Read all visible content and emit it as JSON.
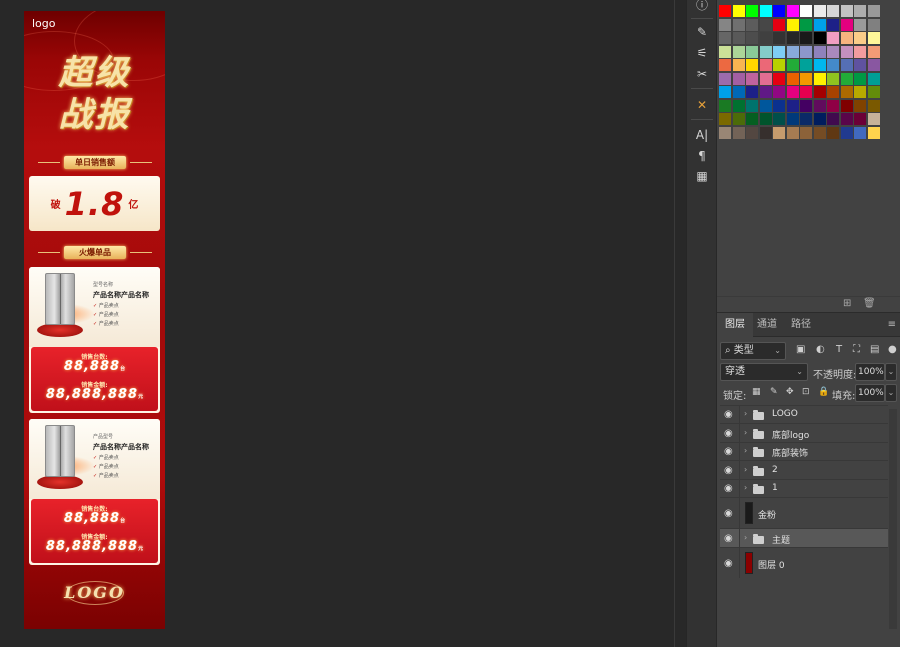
{
  "canvas": {
    "logo_top": "logo",
    "headline_line1": "超级",
    "headline_line2": "战报",
    "ribbon_daily": "单日销售额",
    "sales_prefix": "破",
    "sales_value": "1.8",
    "sales_suffix": "亿",
    "ribbon_hot": "火爆单品",
    "products": [
      {
        "tag": "型号名称",
        "name": "产品名称产品名称",
        "features": [
          "产品卖点",
          "产品卖点",
          "产品卖点"
        ],
        "units_label": "销售台数:",
        "units_value": "88,888",
        "units_unit": "台",
        "amount_label": "销售金额:",
        "amount_value": "88,888,888",
        "amount_unit": "元"
      },
      {
        "tag": "产品型号",
        "name": "产品名称产品名称",
        "features": [
          "产品卖点",
          "产品卖点",
          "产品卖点"
        ],
        "units_label": "销售台数:",
        "units_value": "88,888",
        "units_unit": "台",
        "amount_label": "销售金额:",
        "amount_value": "88,888,888",
        "amount_unit": "元"
      }
    ],
    "logo_bottom": "LOGO"
  },
  "toolbar": {
    "icons": [
      "info-icon",
      "brush-settings-icon",
      "adjustments-icon",
      "clone-tool-icon",
      "tools-crossed-icon",
      "character-icon",
      "paragraph-icon",
      "glyphs-icon"
    ]
  },
  "swatches": {
    "rows": [
      [
        "#ff0000",
        "#ffff00",
        "#00ff00",
        "#00ffff",
        "#0000ff",
        "#ff00ff",
        "#ffffff",
        "#ebebeb",
        "#d6d6d6",
        "#c2c2c2",
        "#adadad",
        "#999999"
      ],
      [
        "#858585",
        "#707070",
        "#5c5c5c",
        "#474747",
        "#e60012",
        "#fff100",
        "#009944",
        "#00a0e9",
        "#1d2088",
        "#e4007f",
        "#9a9a9a",
        "#808080"
      ],
      [
        "#666666",
        "#595959",
        "#4d4d4d",
        "#404040",
        "#333333",
        "#262626",
        "#1a1a1a",
        "#000000",
        "#f19ec2",
        "#f6b37f",
        "#facd89",
        "#fff799"
      ],
      [
        "#cce198",
        "#acd598",
        "#89c997",
        "#84ccc9",
        "#7ecef4",
        "#88abda",
        "#8c97cb",
        "#8f82bc",
        "#aa89bd",
        "#c490bf",
        "#f29c9f",
        "#f29b76"
      ],
      [
        "#ec6941",
        "#f8b551",
        "#ffd800",
        "#eb6877",
        "#b8d200",
        "#22ac38",
        "#00a29a",
        "#00b7ee",
        "#448aca",
        "#556fb5",
        "#5f52a0",
        "#8957a1"
      ],
      [
        "#9c6bac",
        "#a35fa3",
        "#c0639e",
        "#e26d92",
        "#e60012",
        "#eb6100",
        "#f39800",
        "#fff100",
        "#8fc31f",
        "#22ac38",
        "#009944",
        "#009e96"
      ],
      [
        "#00a0e9",
        "#0068b7",
        "#1d2088",
        "#601986",
        "#920783",
        "#e4007f",
        "#e5004f",
        "#a40000",
        "#a84200",
        "#ac6a00",
        "#b7aa00",
        "#638c0b"
      ],
      [
        "#1a7a23",
        "#007130",
        "#00736d",
        "#00579c",
        "#0b318f",
        "#1d2088",
        "#440062",
        "#610b5d",
        "#8f0045",
        "#800000",
        "#804200",
        "#7a5900"
      ],
      [
        "#7a6900",
        "#4c6b09",
        "#055f21",
        "#00542c",
        "#004f4a",
        "#00397a",
        "#0b2a67",
        "#001d5e",
        "#400a4e",
        "#5a054a",
        "#6b0037",
        "#c7b299"
      ],
      [
        "#998675",
        "#736357",
        "#534741",
        "#362f2d",
        "#c69c6d",
        "#a67c52",
        "#8c6239",
        "#754c24",
        "#603813",
        "#213a8f",
        "#4169bf",
        "#ffd34d"
      ]
    ],
    "new_swatch_icon": "new-swatch-icon",
    "delete_icon": "trash-icon"
  },
  "layers_panel": {
    "tabs": [
      "图层",
      "通道",
      "路径"
    ],
    "active_tab": "图层",
    "kind_filter": "类型",
    "blend_mode": "穿透",
    "opacity_label": "不透明度:",
    "opacity_value": "100%",
    "lock_label": "锁定:",
    "fill_label": "填充:",
    "fill_value": "100%",
    "layers": [
      {
        "name": "LOGO",
        "type": "group",
        "selected": false
      },
      {
        "name": "底部logo",
        "type": "group",
        "selected": false
      },
      {
        "name": "底部装饰",
        "type": "group",
        "selected": false
      },
      {
        "name": "2",
        "type": "group",
        "selected": false
      },
      {
        "name": "1",
        "type": "group",
        "selected": false
      },
      {
        "name": "金粉",
        "type": "layer",
        "selected": false,
        "thumb_color": "#1a1a1a"
      },
      {
        "name": "主题",
        "type": "group",
        "selected": true
      },
      {
        "name": "图层 0",
        "type": "layer",
        "selected": false,
        "thumb_color": "#8a0000"
      }
    ]
  }
}
